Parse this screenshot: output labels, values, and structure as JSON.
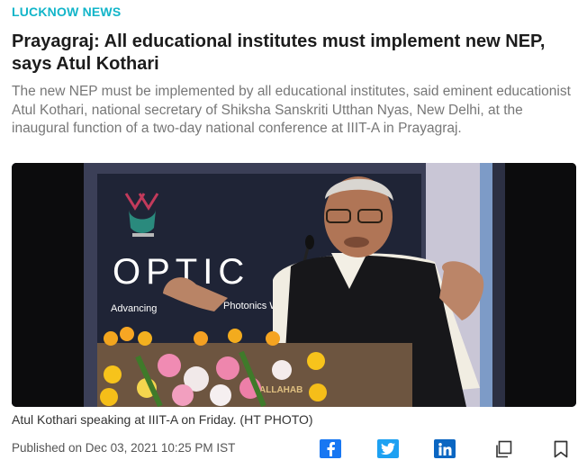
{
  "section": {
    "label": "LUCKNOW NEWS"
  },
  "headline": "Prayagraj: All educational institutes must implement new NEP, says Atul Kothari",
  "summary": "The new NEP must be implemented by all educational institutes, said eminent educationist Atul Kothari, national secretary of Shiksha Sanskriti Utthan Nyas, New Delhi, at the inaugural function of a two-day national conference at IIIT-A in Prayagraj.",
  "photo": {
    "banner_text": "OPTIC",
    "banner_subtext": "Advancing",
    "banner_subtext2": "Photonics W",
    "podium_text": "ALLAHAB"
  },
  "caption": "Atul Kothari speaking at IIIT-A on Friday. (HT PHOTO)",
  "meta": {
    "published": "Published on Dec 03, 2021 10:25 PM IST"
  },
  "share": [
    {
      "icon": "facebook-icon"
    },
    {
      "icon": "twitter-icon"
    },
    {
      "icon": "linkedin-icon"
    },
    {
      "icon": "copy-icon"
    },
    {
      "icon": "bookmark-icon"
    }
  ],
  "colors": {
    "accent": "#12b5c9",
    "facebook": "#1877f2",
    "twitter": "#1da1f2",
    "linkedin": "#0a66c2"
  }
}
